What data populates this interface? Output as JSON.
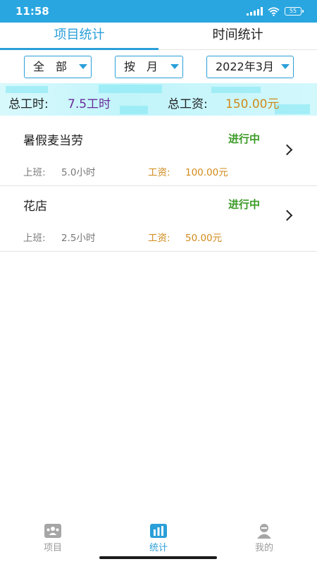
{
  "status_bar": {
    "time": "11:58",
    "battery": "55"
  },
  "tabs": [
    {
      "label": "项目统计",
      "active": true
    },
    {
      "label": "时间统计",
      "active": false
    }
  ],
  "filters": {
    "category": "全　部",
    "period": "按　月",
    "month": "2022年3月"
  },
  "totals": {
    "hours_label": "总工时:",
    "hours_value": "7.5工时",
    "pay_label": "总工资:",
    "pay_value": "150.00元"
  },
  "projects": [
    {
      "name": "暑假麦当劳",
      "status": "进行中",
      "work_label": "上班:",
      "work_value": "5.0小时",
      "pay_label": "工资:",
      "pay_value": "100.00元"
    },
    {
      "name": "花店",
      "status": "进行中",
      "work_label": "上班:",
      "work_value": "2.5小时",
      "pay_label": "工资:",
      "pay_value": "50.00元"
    }
  ],
  "bottom_nav": [
    {
      "label": "项目",
      "icon": "people-icon",
      "active": false
    },
    {
      "label": "统计",
      "icon": "bar-chart-icon",
      "active": true
    },
    {
      "label": "我的",
      "icon": "user-icon",
      "active": false
    }
  ],
  "colors": {
    "accent": "#2a9fd8",
    "status_green": "#3c9a26",
    "pay_orange": "#d08a1a",
    "hours_purple": "#6a2a9a"
  }
}
